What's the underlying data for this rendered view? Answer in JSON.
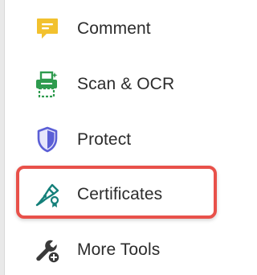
{
  "tools": {
    "items": [
      {
        "label": "Comment",
        "icon": "comment-icon",
        "color": "#f2c12e"
      },
      {
        "label": "Scan & OCR",
        "icon": "scan-ocr-icon",
        "color": "#2e9b4e"
      },
      {
        "label": "Protect",
        "icon": "shield-icon",
        "color": "#5b5fd6"
      },
      {
        "label": "Certificates",
        "icon": "certificate-pen-icon",
        "color": "#15807a"
      },
      {
        "label": "More Tools",
        "icon": "wrench-add-icon",
        "color": "#3a3a3a"
      }
    ]
  },
  "highlight": {
    "target": "Certificates",
    "color": "#e8514a"
  }
}
